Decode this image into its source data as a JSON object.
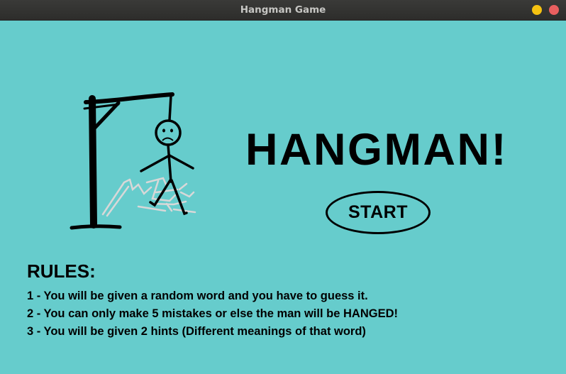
{
  "window": {
    "title": "Hangman Game",
    "controls": [
      "minimize-icon",
      "close-icon"
    ]
  },
  "colors": {
    "background": "#66cccc",
    "text": "#000000",
    "minimize": "#f5c211",
    "close": "#e95f5f"
  },
  "game": {
    "title": "HANGMAN!",
    "start_label": "START"
  },
  "rules": {
    "heading": "RULES:",
    "items": [
      "1 - You will be given a random word and you have to guess it.",
      "2 - You can only make 5 mistakes or else the man will be HANGED!",
      "3 - You will be given 2 hints (Different meanings of that word)"
    ]
  }
}
